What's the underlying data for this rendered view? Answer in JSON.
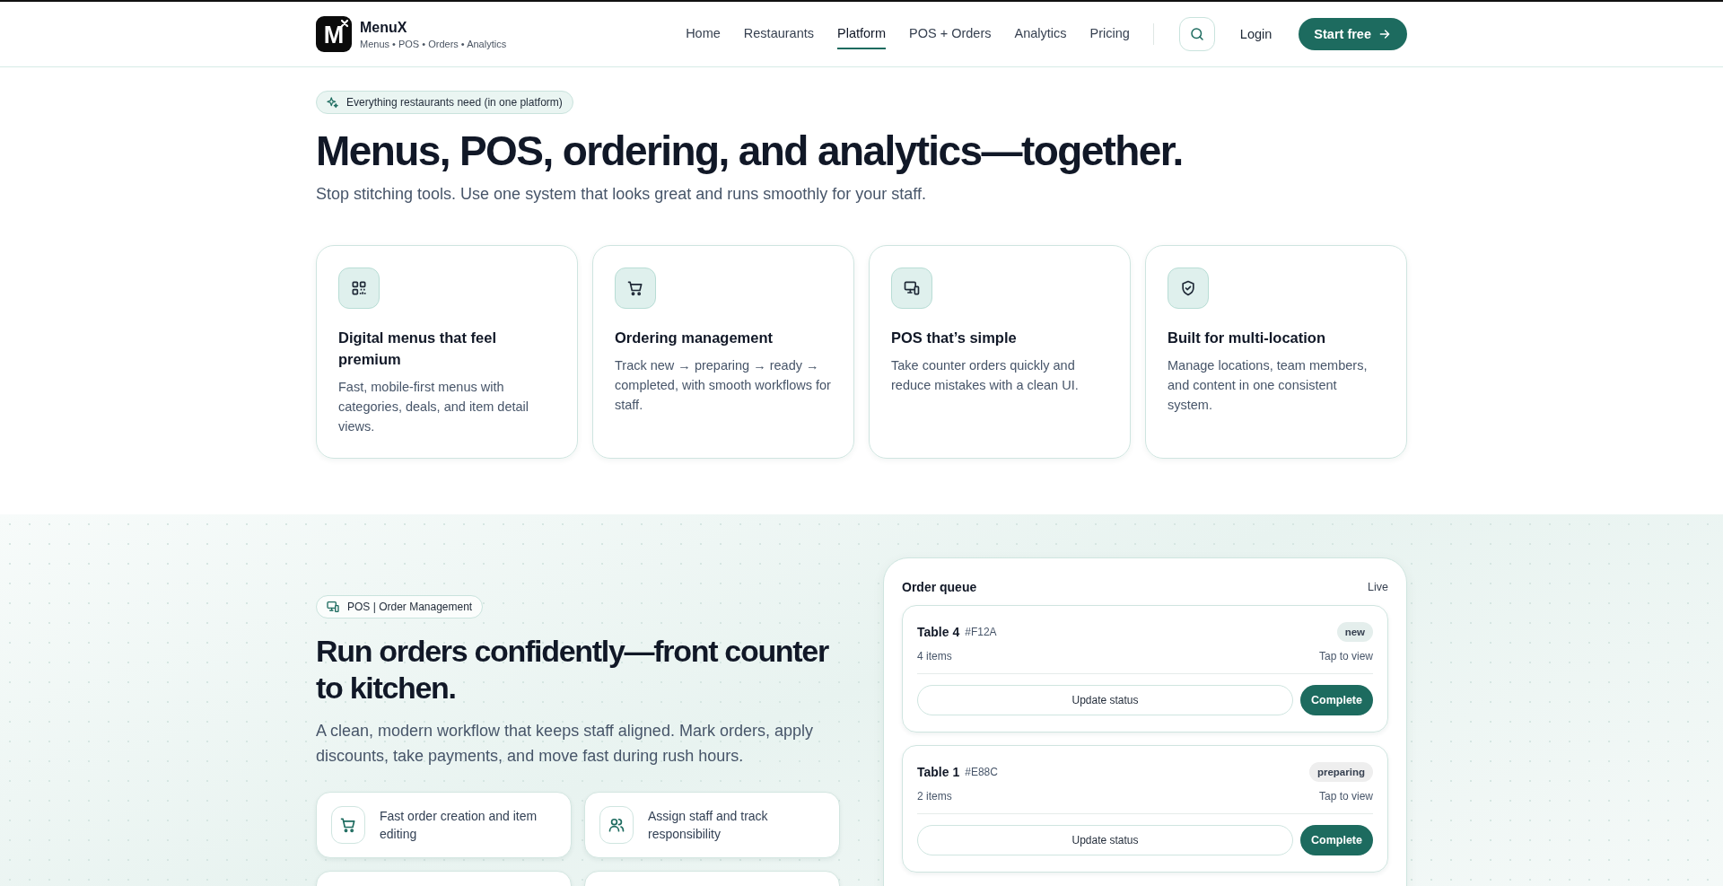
{
  "brand": {
    "logo_mark": "M",
    "name": "MenuX",
    "tagline": "Menus • POS • Orders • Analytics"
  },
  "nav": [
    {
      "label": "Home",
      "selected": false
    },
    {
      "label": "Restaurants",
      "selected": false
    },
    {
      "label": "Platform",
      "selected": true
    },
    {
      "label": "POS + Orders",
      "selected": false
    },
    {
      "label": "Analytics",
      "selected": false
    },
    {
      "label": "Pricing",
      "selected": false
    }
  ],
  "header_actions": {
    "login": "Login",
    "cta": "Start free"
  },
  "hero": {
    "badge": "Everything restaurants need (in one platform)",
    "title": "Menus, POS, ordering, and analytics—together.",
    "subtitle": "Stop stitching tools. Use one system that looks great and runs smoothly for your staff."
  },
  "features": [
    {
      "kind": "qr",
      "title": "Digital menus that feel premium",
      "text": "Fast, mobile-first menus with categories, deals, and item detail views."
    },
    {
      "kind": "cart",
      "title": "Ordering management",
      "text": "Track new → preparing → ready → completed, with smooth workflows for staff."
    },
    {
      "kind": "devices",
      "title": "POS that’s simple",
      "text": "Take counter orders quickly and reduce mistakes with a clean UI."
    },
    {
      "kind": "shield",
      "title": "Built for multi-location",
      "text": "Manage locations, team members, and content in one consistent system."
    }
  ],
  "pos": {
    "badge": "POS | Order Management",
    "title": "Run orders confidently—front counter to kitchen.",
    "text": "A clean, modern workflow that keeps staff aligned. Mark orders, apply discounts, take payments, and move fast during rush hours.",
    "highlights": [
      {
        "kind": "cart",
        "text": "Fast order creation and item editing"
      },
      {
        "kind": "users",
        "text": "Assign staff and track responsibility"
      }
    ]
  },
  "order_queue": {
    "title": "Order queue",
    "status": "Live",
    "orders": [
      {
        "table": "Table 4",
        "code": "#F12A",
        "status": "new",
        "color": "#e4eeec",
        "items": "4 items",
        "hint": "Tap to view",
        "secondary": "Update status",
        "primary": "Complete"
      },
      {
        "table": "Table 1",
        "code": "#E88C",
        "status": "preparing",
        "color": "#eeeeee",
        "items": "2 items",
        "hint": "Tap to view",
        "secondary": "Update status",
        "primary": "Complete"
      }
    ]
  }
}
